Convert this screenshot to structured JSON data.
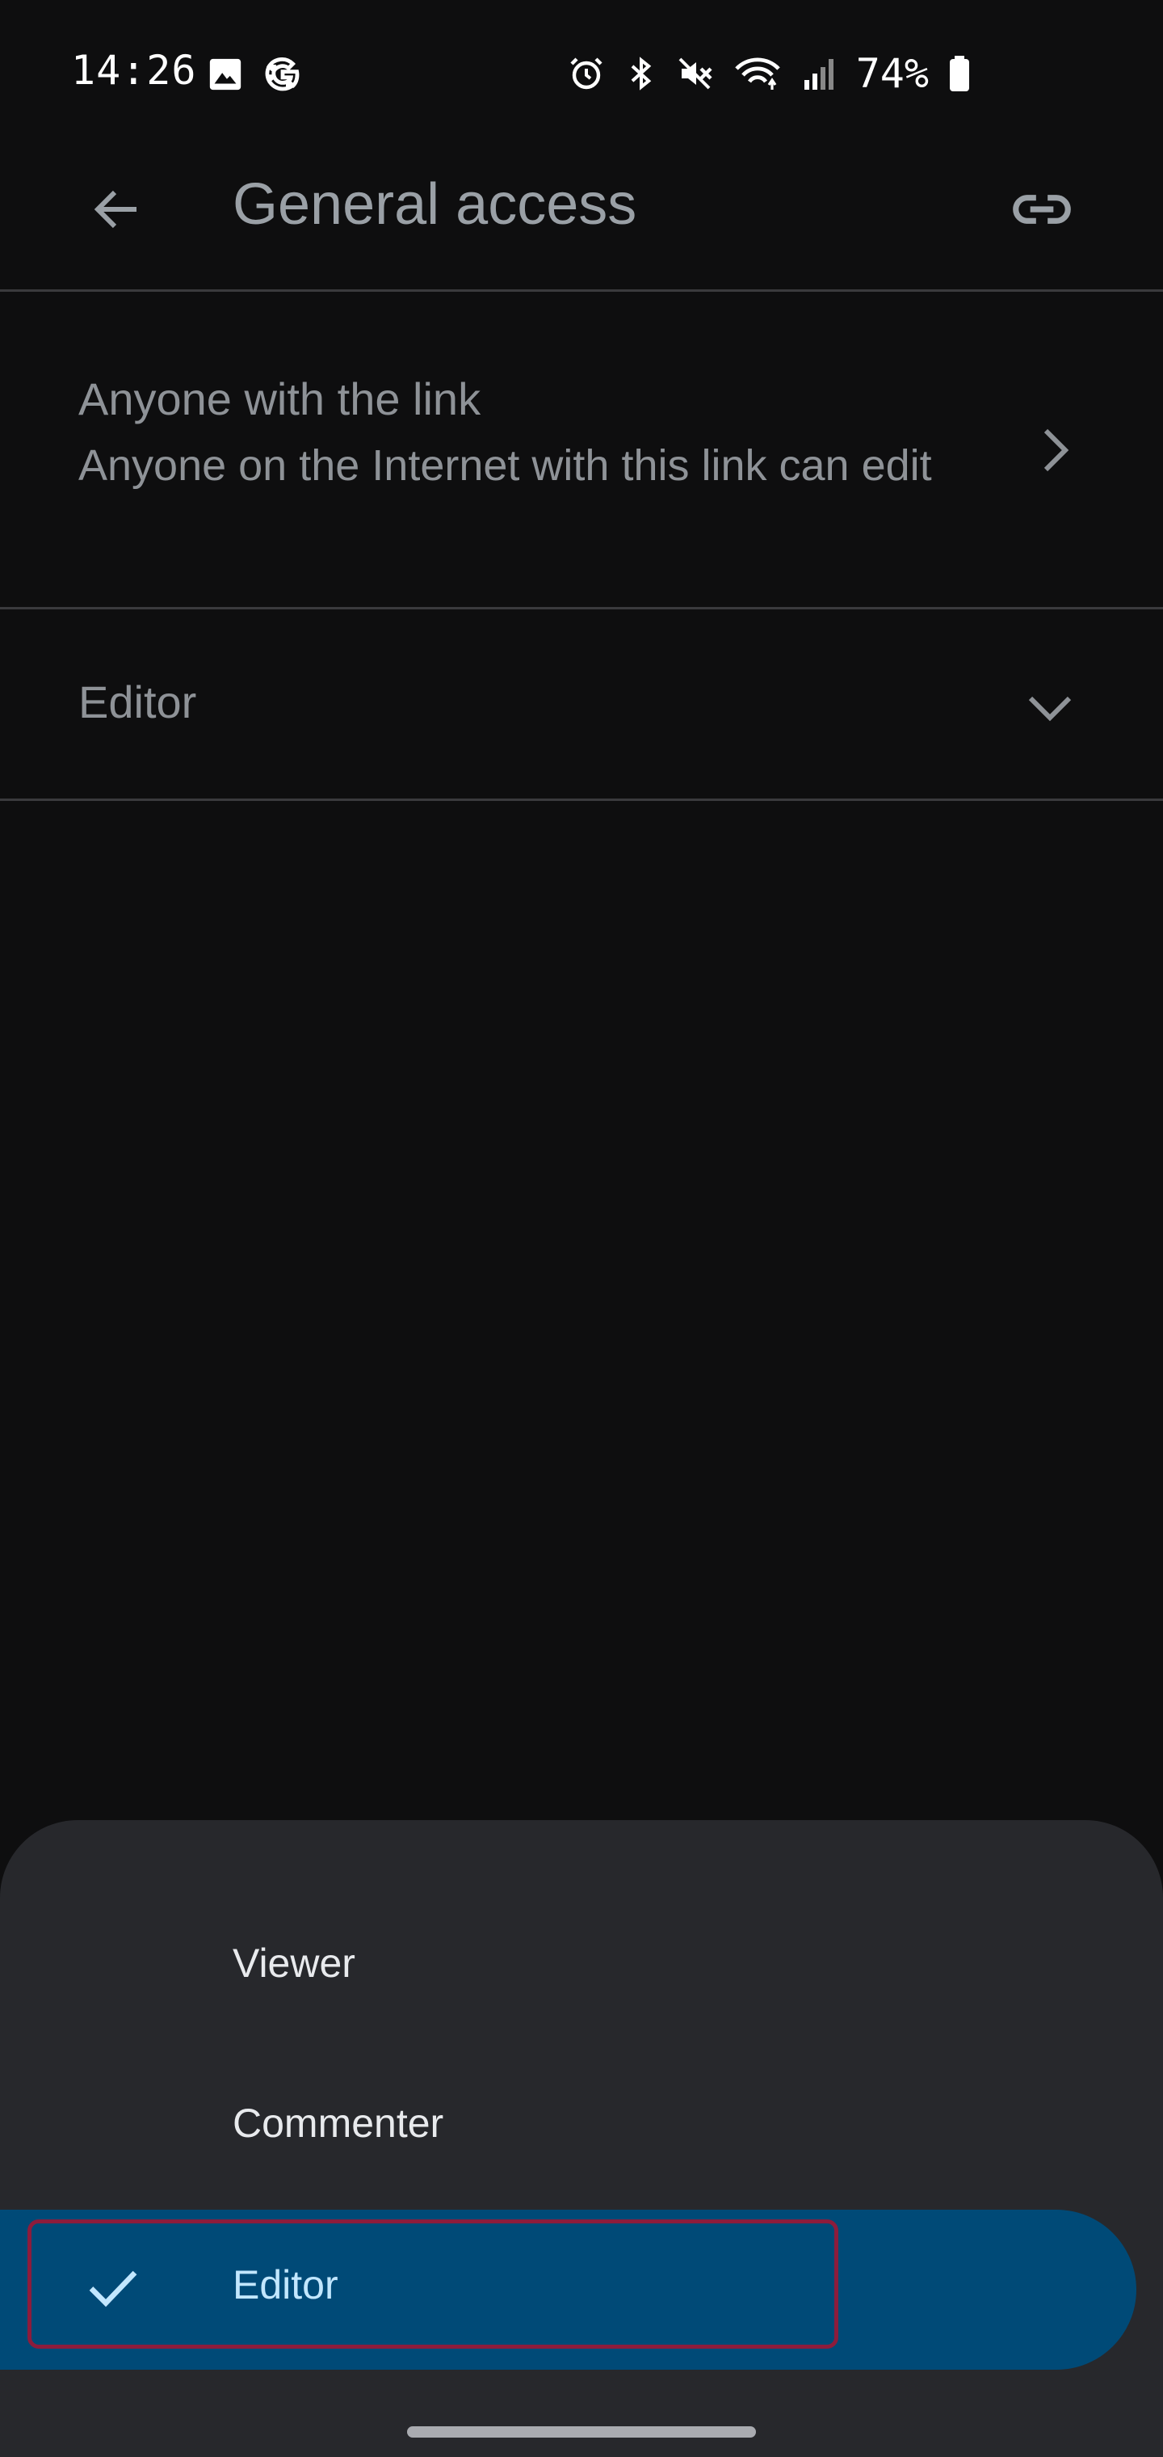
{
  "status_bar": {
    "time": "14:26",
    "battery": "74%",
    "icons": [
      "image-icon",
      "google-icon",
      "alarm-icon",
      "bluetooth-icon",
      "mute-icon",
      "wifi-icon",
      "signal-icon",
      "battery-icon"
    ]
  },
  "app_bar": {
    "title": "General access",
    "back_icon": "arrow-back-icon",
    "link_icon": "link-icon"
  },
  "access_row": {
    "title": "Anyone with the link",
    "subtitle": "Anyone on the Internet with this link can edit"
  },
  "role_row": {
    "selected_role": "Editor"
  },
  "role_sheet": {
    "options": [
      {
        "label": "Viewer",
        "selected": false
      },
      {
        "label": "Commenter",
        "selected": false
      },
      {
        "label": "Editor",
        "selected": true
      }
    ]
  },
  "colors": {
    "background": "#0e0e0f",
    "sheet": "#27282c",
    "selected": "#004a77",
    "selected_text": "#c2e7ff",
    "highlight_outline": "#8c1c3c"
  }
}
